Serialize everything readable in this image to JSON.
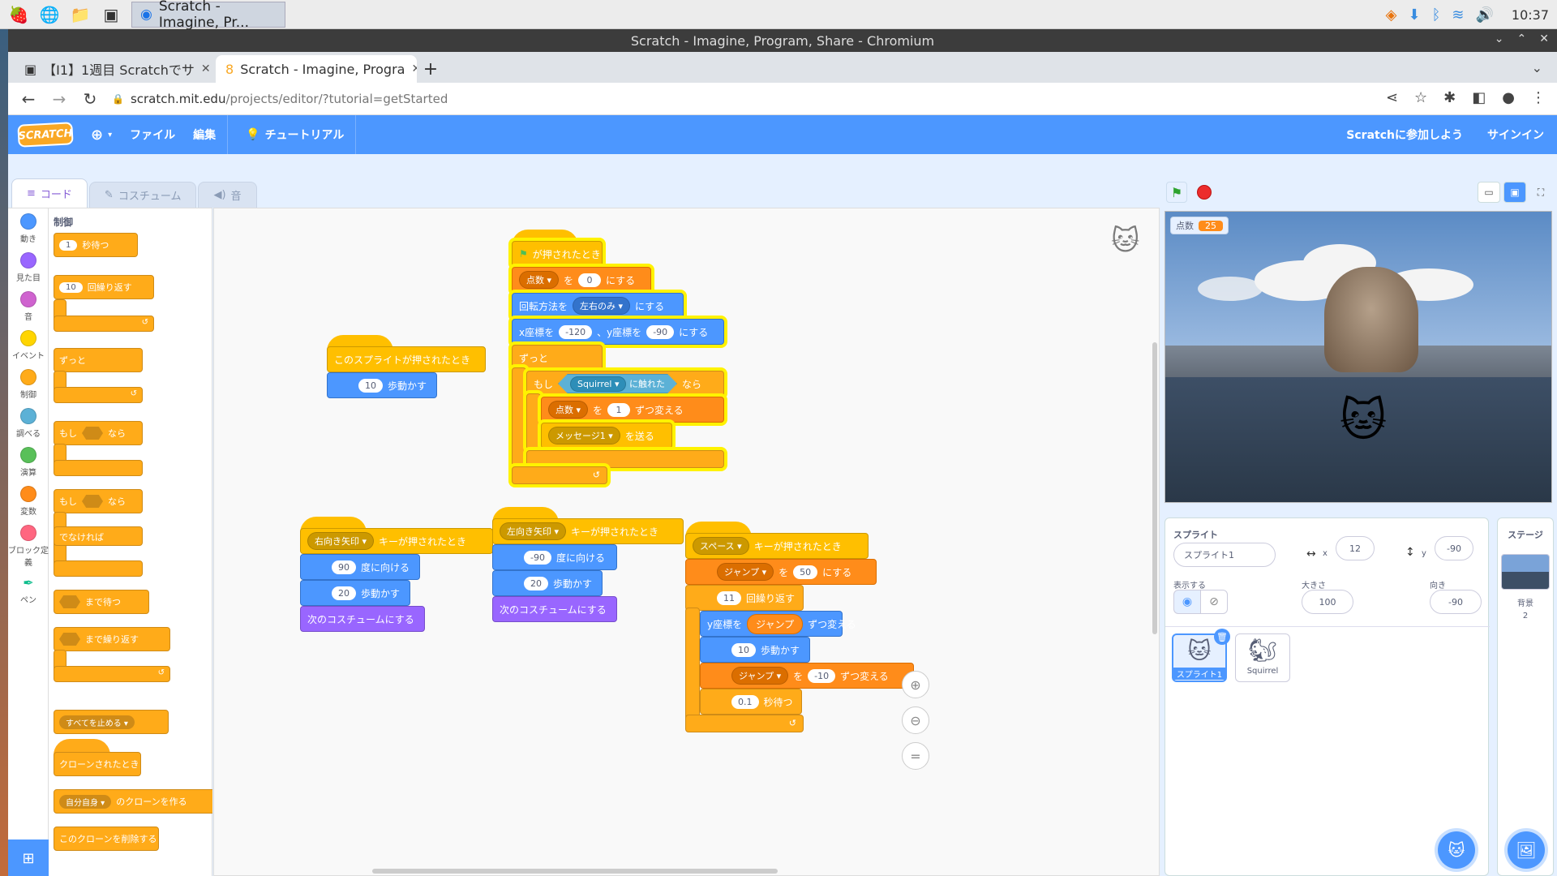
{
  "taskbar": {
    "app_label": "Scratch - Imagine, Pr...",
    "clock": "10:37"
  },
  "window": {
    "title": "Scratch - Imagine, Program, Share - Chromium"
  },
  "tabs": [
    {
      "label": "【I1】1週目 Scratchでサ"
    },
    {
      "label": "Scratch - Imagine, Progra"
    }
  ],
  "address": {
    "host": "scratch.mit.edu",
    "path": "/projects/editor/?tutorial=getStarted"
  },
  "menubar": {
    "logo": "SCRATCH",
    "file": "ファイル",
    "edit": "編集",
    "tutorials": "チュートリアル",
    "join": "Scratchに参加しよう",
    "signin": "サインイン"
  },
  "editor_tabs": {
    "code": "コード",
    "costumes": "コスチューム",
    "sounds": "音"
  },
  "categories": [
    {
      "label": "動き",
      "color": "#4c97ff"
    },
    {
      "label": "見た目",
      "color": "#9966ff"
    },
    {
      "label": "音",
      "color": "#cf63cf"
    },
    {
      "label": "イベント",
      "color": "#ffd500"
    },
    {
      "label": "制御",
      "color": "#ffab19"
    },
    {
      "label": "調べる",
      "color": "#5cb1d6"
    },
    {
      "label": "演算",
      "color": "#59c059"
    },
    {
      "label": "変数",
      "color": "#ff8c1a"
    },
    {
      "label": "ブロック定義",
      "color": "#ff6680"
    },
    {
      "label": "ペン",
      "color": "#0fbd8c"
    }
  ],
  "palette": {
    "title": "制御",
    "wait_val": "1",
    "wait": "秒待つ",
    "repeat_val": "10",
    "repeat": "回繰り返す",
    "forever": "ずっと",
    "if": "もし",
    "then": "なら",
    "else": "でなければ",
    "wait_until": "まで待つ",
    "repeat_until": "まで繰り返す",
    "stop_all": "すべてを止める",
    "when_clone": "クローンされたとき",
    "myself": "自分自身",
    "create_clone": "のクローンを作る",
    "delete_clone": "このクローンを削除する"
  },
  "scripts": {
    "main": {
      "hat": "が押されたとき",
      "set_var": "点数",
      "wo": "を",
      "set_val": "0",
      "nisuru": "にする",
      "rot_prefix": "回転方法を",
      "rot_val": "左右のみ",
      "rot_suffix": "にする",
      "x_prefix": "x座標を",
      "x_val": "-120",
      "y_prefix": "、y座標を",
      "y_val": "-90",
      "xy_suffix": "にする",
      "forever": "ずっと",
      "if": "もし",
      "sense_target": "Squirrel",
      "touching": "に触れた",
      "then": "なら",
      "change_var": "点数",
      "change_wo": "を",
      "change_val": "1",
      "change_suffix": "ずつ変える",
      "broadcast": "メッセージ1",
      "broadcast_suffix": "を送る"
    },
    "sprite_click": {
      "hat": "このスプライトが押されたとき",
      "move_val": "10",
      "move": "歩動かす"
    },
    "right": {
      "key": "右向き矢印",
      "hat": "キーが押されたとき",
      "dir_val": "90",
      "dir": "度に向ける",
      "move_val": "20",
      "move": "歩動かす",
      "next": "次のコスチュームにする"
    },
    "left": {
      "key": "左向き矢印",
      "hat": "キーが押されたとき",
      "dir_val": "-90",
      "dir": "度に向ける",
      "move_val": "20",
      "move": "歩動かす",
      "next": "次のコスチュームにする"
    },
    "space": {
      "key": "スペース",
      "hat": "キーが押されたとき",
      "var": "ジャンプ",
      "wo": "を",
      "set_val": "50",
      "nisuru": "にする",
      "repeat_val": "11",
      "repeat": "回繰り返す",
      "y_prefix": "y座標を",
      "y_var": "ジャンプ",
      "y_suffix": "ずつ変える",
      "move_val": "10",
      "move": "歩動かす",
      "var2": "ジャンプ",
      "wo2": "を",
      "change_val": "-10",
      "change_suffix": "ずつ変える",
      "wait_val": "0.1",
      "wait": "秒待つ"
    }
  },
  "stage": {
    "monitor_label": "点数",
    "monitor_value": "25"
  },
  "sprite_info": {
    "heading": "スプライト",
    "name": "スプライト1",
    "x_label": "x",
    "x": "12",
    "y_label": "y",
    "y": "-90",
    "show_label": "表示する",
    "size_label": "大きさ",
    "size": "100",
    "dir_label": "向き",
    "direction": "-90"
  },
  "sprites": [
    {
      "name": "スプライト1"
    },
    {
      "name": "Squirrel"
    }
  ],
  "stage_pane": {
    "title": "ステージ",
    "backdrop_label": "背景",
    "backdrop_count": "2"
  }
}
